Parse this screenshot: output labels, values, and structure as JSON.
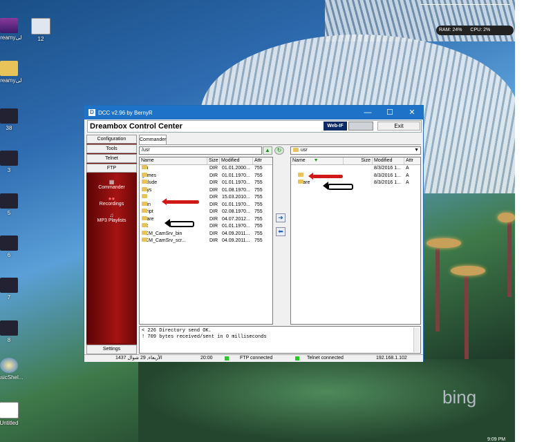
{
  "desktop": {
    "icons": [
      {
        "label": "Dreamyلی"
      },
      {
        "label": "12"
      },
      {
        "label": "Dreamyلی"
      },
      {
        "label": "38"
      },
      {
        "label": "3"
      },
      {
        "label": "5"
      },
      {
        "label": "6"
      },
      {
        "label": "7"
      },
      {
        "label": "8"
      },
      {
        "label": "assicShel..."
      },
      {
        "label": "Untitled"
      }
    ],
    "sysmon": {
      "ram": "RAM: 24%",
      "cpu": "CPU: 2%"
    },
    "bing": "bing",
    "clock": "9:09 PM"
  },
  "window": {
    "title": "DCC v2.96 by BernyR",
    "app_title": "Dreambox Control Center",
    "webif_logo": "Web-IF",
    "exit_label": "Exit",
    "sidebar": {
      "buttons": [
        "Configuration",
        "Tools",
        "Telnet",
        "FTP"
      ],
      "nav": [
        {
          "label": "Commander",
          "icon": "commander-icon"
        },
        {
          "label": "Recordings",
          "icon": "recordings-icon"
        },
        {
          "label": "MP3 Playlists",
          "icon": "playlist-icon"
        }
      ],
      "settings_label": "Settings"
    },
    "tab_label": "Commander",
    "left_panel": {
      "path": "/usr",
      "columns": [
        "Name",
        "Size",
        "Modified",
        "Attr"
      ],
      "rows": [
        {
          "name": "bin",
          "size": "DIR",
          "modified": "01.01.2000...",
          "attr": "755"
        },
        {
          "name": "games",
          "size": "DIR",
          "modified": "01.01.1970...",
          "attr": "755"
        },
        {
          "name": "include",
          "size": "DIR",
          "modified": "01.01.1970...",
          "attr": "755"
        },
        {
          "name": "keys",
          "size": "DIR",
          "modified": "01.08.1970...",
          "attr": "755"
        },
        {
          "name": "lib",
          "size": "DIR",
          "modified": "15.03.2010...",
          "attr": "755"
        },
        {
          "name": "sbin",
          "size": "DIR",
          "modified": "01.01.1970...",
          "attr": "755"
        },
        {
          "name": "script",
          "size": "DIR",
          "modified": "02.08.1970...",
          "attr": "755"
        },
        {
          "name": "share",
          "size": "DIR",
          "modified": "04.07.2012...",
          "attr": "755"
        },
        {
          "name": "src",
          "size": "DIR",
          "modified": "01.01.1970...",
          "attr": "755"
        },
        {
          "name": "UCM_CamSrv_bin",
          "size": "DIR",
          "modified": "04.09.2011...",
          "attr": "755"
        },
        {
          "name": "UCM_CamSrv_scr...",
          "size": "DIR",
          "modified": "04.09.2011...",
          "attr": "755"
        }
      ]
    },
    "right_panel": {
      "path": "usr",
      "columns": [
        "Name",
        "Size",
        "Modified",
        "Attr"
      ],
      "rows": [
        {
          "name": "..",
          "size": "",
          "modified": "8/3/2016 1...",
          "attr": "A"
        },
        {
          "name": "lib",
          "size": "",
          "modified": "8/3/2016 1...",
          "attr": "A"
        },
        {
          "name": "share",
          "size": "",
          "modified": "8/3/2016 1...",
          "attr": "A"
        }
      ]
    },
    "log": [
      "< 226 Directory send OK.",
      "! 709 bytes received/sent in 0 milliseconds"
    ],
    "status": {
      "date": "الأربعاء, 29 شوال 1437",
      "time": "20:00",
      "ftp": "FTP connected",
      "telnet": "Telnet connected",
      "ip": "192.168.1.102"
    }
  },
  "colors": {
    "titlebar": "#1e73c8",
    "sidebar_red": "#a51313",
    "led_green": "#22cc22"
  }
}
